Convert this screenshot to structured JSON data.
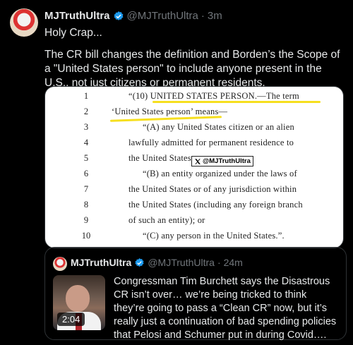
{
  "post": {
    "author_name": "MJTruthUltra",
    "handle": "@MJTruthUltra",
    "separator": "·",
    "time": "3m",
    "text_line1": "Holy Crap...",
    "text_line2": "The CR bill changes the definition and Borden’s the Scope of a \"United States person\" to include anyone present in the U.S., not just citizens or permanent residents."
  },
  "document": {
    "lines": [
      {
        "num": "1",
        "text": "“(10) UNITED STATES PERSON.—The term"
      },
      {
        "num": "2",
        "text": "‘United States person’ means—"
      },
      {
        "num": "3",
        "text": "“(A) any United States citizen or an alien"
      },
      {
        "num": "4",
        "text": "lawfully admitted for permanent residence to"
      },
      {
        "num": "5",
        "text": "the United States;"
      },
      {
        "num": "6",
        "text": "“(B) an entity organized under the laws of"
      },
      {
        "num": "7",
        "text": "the United States or of any jurisdiction within"
      },
      {
        "num": "8",
        "text": "the United States (including any foreign branch"
      },
      {
        "num": "9",
        "text": "of such an entity); or"
      },
      {
        "num": "10",
        "text": "“(C) any person in the United States.”."
      }
    ],
    "watermark": "@MJTruthUltra",
    "highlight_color": "#f6df1f"
  },
  "quote": {
    "author_name": "MJTruthUltra",
    "handle": "@MJTruthUltra",
    "separator": "·",
    "time": "24m",
    "video_duration": "2:04",
    "text": "Congressman Tim Burchett says the Disastrous CR isn’t over… we’re being tricked to think they’re going to pass a “Clean CR” now, but it’s really just a continuation of bad spending policies that Pelosi and Schumer put in during Covid…."
  },
  "colors": {
    "background": "#000000",
    "verified": "#1d9bf0",
    "muted": "#71767b"
  }
}
